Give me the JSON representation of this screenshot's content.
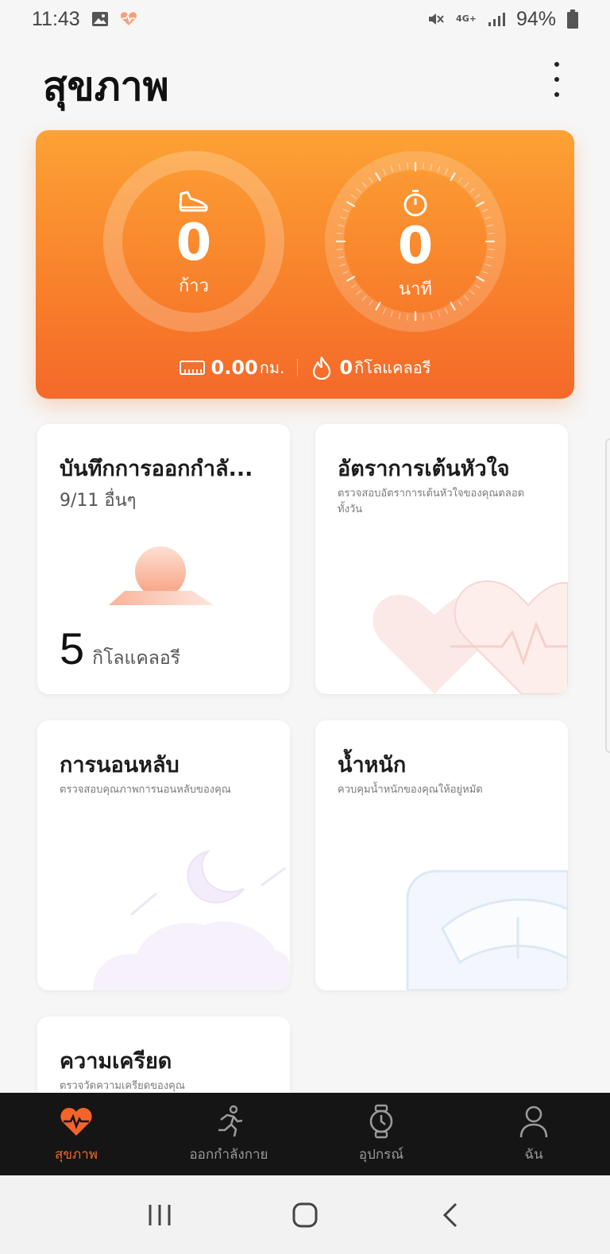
{
  "status_bar": {
    "time": "11:43",
    "network": "4G+",
    "battery": "94%"
  },
  "header": {
    "title": "สุขภาพ"
  },
  "hero": {
    "steps_value": "0",
    "steps_unit": "ก้าว",
    "time_value": "0",
    "time_unit": "นาที",
    "distance_value": "0.00",
    "distance_unit": "กม.",
    "calories_value": "0",
    "calories_unit": "กิโลแคลอรี"
  },
  "cards": {
    "exercise": {
      "title": "บันทึกการออกกำลั...",
      "subtitle": "9/11 อื่นๆ",
      "value": "5",
      "unit": "กิโลแคลอรี"
    },
    "heart_rate": {
      "title": "อัตราการเต้นหัวใจ",
      "subtitle": "ตรวจสอบอัตราการเต้นหัวใจของคุณตลอดทั้งวัน"
    },
    "sleep": {
      "title": "การนอนหลับ",
      "subtitle": "ตรวจสอบคุณภาพการนอนหลับของคุณ"
    },
    "weight": {
      "title": "น้ำหนัก",
      "subtitle": "ควบคุมน้ำหนักของคุณให้อยู่หมัด"
    },
    "stress": {
      "title": "ความเครียด",
      "subtitle": "ตรวจวัดความเครียดของคุณ"
    }
  },
  "bottom_nav": [
    {
      "label": "สุขภาพ",
      "icon": "heart-pulse-icon",
      "active": true
    },
    {
      "label": "ออกกำลังกาย",
      "icon": "runner-icon",
      "active": false
    },
    {
      "label": "อุปกรณ์",
      "icon": "watch-icon",
      "active": false
    },
    {
      "label": "ฉัน",
      "icon": "person-icon",
      "active": false
    }
  ],
  "colors": {
    "accent": "#f3642a",
    "hero_top": "#fca234",
    "hero_bottom": "#f4692a"
  }
}
